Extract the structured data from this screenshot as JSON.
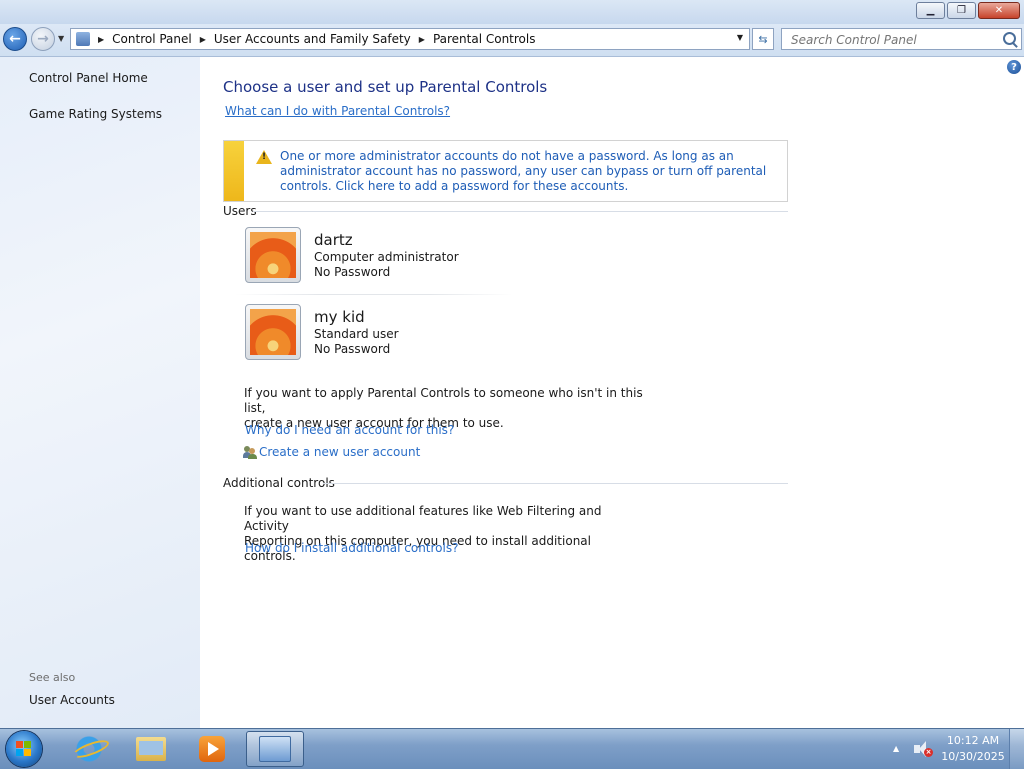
{
  "window": {
    "caption_buttons": [
      "minimize",
      "restore",
      "close"
    ]
  },
  "address_bar": {
    "breadcrumbs": [
      "Control Panel",
      "User Accounts and Family Safety",
      "Parental Controls"
    ],
    "search_placeholder": "Search Control Panel"
  },
  "left_pane": {
    "links": [
      "Control Panel Home",
      "Game Rating Systems"
    ],
    "see_also_label": "See also",
    "see_also_links": [
      "User Accounts"
    ]
  },
  "main": {
    "title": "Choose a user and set up Parental Controls",
    "what_link": "What can I do with Parental Controls?",
    "warning": "One or more administrator accounts do not have a password. As long as an administrator account has no password, any user can bypass or turn off parental controls. Click here to add a password for these accounts.",
    "users_heading": "Users",
    "users": [
      {
        "name": "dartz",
        "role": "Computer administrator",
        "password": "No Password"
      },
      {
        "name": "my kid",
        "role": "Standard user",
        "password": "No Password"
      }
    ],
    "apply_text_line1": "If you want to apply Parental Controls to someone who isn't in this list,",
    "apply_text_line2": "create a new user account for them to use.",
    "why_link": "Why do I need an account for this?",
    "create_link": "Create a new user account",
    "additional_heading": "Additional controls",
    "additional_text_line1": "If you want to use additional features like Web Filtering and Activity",
    "additional_text_line2": "Reporting on this computer, you need to install additional controls.",
    "install_link": "How do I install additional controls?"
  },
  "taskbar": {
    "pinned": [
      "internet-explorer",
      "windows-explorer",
      "windows-media-player",
      "control-panel"
    ],
    "active": "control-panel",
    "clock_time": "10:12 AM",
    "clock_date": "10/30/2025"
  },
  "colors": {
    "link": "#2a6ec8",
    "title": "#1e3287",
    "warning_stripe": "#f2c42c"
  }
}
